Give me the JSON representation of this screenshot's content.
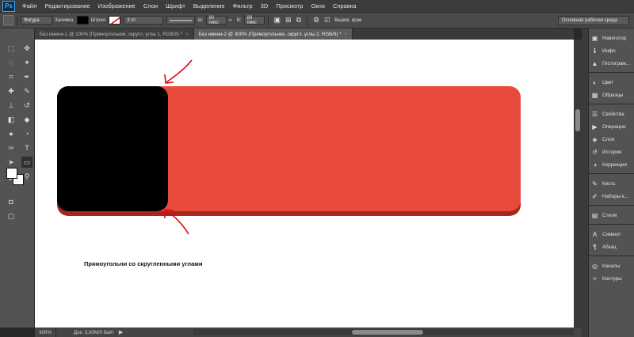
{
  "app": {
    "logo": "Ps",
    "menu": [
      "Файл",
      "Редактирование",
      "Изображение",
      "Слои",
      "Шрифт",
      "Выделение",
      "Фильтр",
      "3D",
      "Просмотр",
      "Окно",
      "Справка"
    ]
  },
  "options_bar": {
    "mode": "Фигура",
    "fill_label": "Заливка:",
    "stroke_label": "Штрих:",
    "stroke_size": "3 пт",
    "w_label": "Ш:",
    "w_value": "80 пикс",
    "h_label": "В:",
    "h_value": "89 пикс",
    "align_edges_label": "Выров. края",
    "workspace": "Основная рабочая среда",
    "fill_color": "#000000"
  },
  "tabs": [
    {
      "label": "Без имени-1 @ 100% (Прямоугольник, скругл. углы 1, RGB/8) *",
      "close": "×"
    },
    {
      "label": "Без имени-2 @ 300% (Прямоугольник, скругл. углы 2, RGB/8) *",
      "close": "×"
    }
  ],
  "canvas": {
    "caption": "Прямоугольни со скругленными углами",
    "shape_color": "#e84b3c",
    "shape_shadow": "#a8261d",
    "overlay_color": "#000000",
    "arrow_color": "#e30613"
  },
  "status": {
    "zoom": "300%",
    "doc": "Док: 3,00M/0 байт"
  },
  "panels": [
    [
      {
        "icon": "navigator-icon",
        "glyph": "▣",
        "label": "Навигатор"
      },
      {
        "icon": "info-icon",
        "glyph": "ℹ",
        "label": "Инфо"
      },
      {
        "icon": "histogram-icon",
        "glyph": "▲",
        "label": "Гистограм..."
      }
    ],
    [
      {
        "icon": "color-icon",
        "glyph": "◐",
        "label": "Цвет"
      },
      {
        "icon": "swatches-icon",
        "glyph": "▦",
        "label": "Образцы"
      }
    ],
    [
      {
        "icon": "properties-icon",
        "glyph": "☰",
        "label": "Свойства"
      },
      {
        "icon": "actions-icon",
        "glyph": "▶",
        "label": "Операции"
      },
      {
        "icon": "layers-icon",
        "glyph": "◈",
        "label": "Слои"
      },
      {
        "icon": "history-icon",
        "glyph": "↺",
        "label": "История"
      },
      {
        "icon": "adjustments-icon",
        "glyph": "◑",
        "label": "Коррекция"
      }
    ],
    [
      {
        "icon": "brush-icon",
        "glyph": "✎",
        "label": "Кисть"
      },
      {
        "icon": "brush-presets-icon",
        "glyph": "✐",
        "label": "Наборы к..."
      }
    ],
    [
      {
        "icon": "styles-icon",
        "glyph": "▤",
        "label": "Стили"
      }
    ],
    [
      {
        "icon": "character-icon",
        "glyph": "A",
        "label": "Символ"
      },
      {
        "icon": "paragraph-icon",
        "glyph": "¶",
        "label": "Абзац"
      }
    ],
    [
      {
        "icon": "channels-icon",
        "glyph": "◎",
        "label": "Каналы"
      },
      {
        "icon": "paths-icon",
        "glyph": "✧",
        "label": "Контуры"
      }
    ]
  ]
}
